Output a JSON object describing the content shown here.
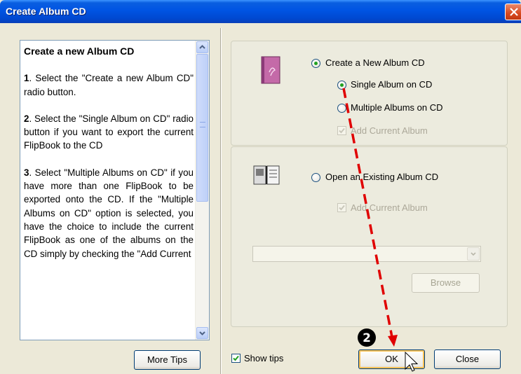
{
  "window": {
    "title": "Create Album CD"
  },
  "tips": {
    "heading": "Create a new Album CD",
    "steps": [
      {
        "num": "1",
        "text": ". Select the \"Create a new Album CD\" radio button."
      },
      {
        "num": "2",
        "text": ". Select the \"Single Album on CD\" radio button if you want to export the current FlipBook to the CD"
      },
      {
        "num": "3",
        "text": ". Select \"Multiple Albums on CD\" if you have more than one FlipBook to be exported onto the CD. If the \"Multiple Albums on CD\" option is selected, you have the choice to include the current FlipBook as one of the albums on the CD simply by checking the \"Add Current"
      }
    ]
  },
  "options": {
    "create_new": {
      "label": "Create a New Album CD",
      "selected": true
    },
    "single": {
      "label": "Single Album on CD",
      "selected": true
    },
    "multiple": {
      "label": "Multiple Albums on CD",
      "selected": false
    },
    "add_current_1": {
      "label": "Add Current Album",
      "checked": true,
      "enabled": false
    },
    "open_existing": {
      "label": "Open an Existing Album CD",
      "selected": false
    },
    "add_current_2": {
      "label": "Add Current Album",
      "checked": true,
      "enabled": false
    },
    "path_value": ""
  },
  "buttons": {
    "more_tips": "More Tips",
    "browse": "Browse",
    "ok": "OK",
    "close": "Close"
  },
  "show_tips": {
    "label": "Show tips",
    "checked": true
  },
  "annotation": {
    "step_badge": "2",
    "color": "#e00000"
  },
  "colors": {
    "titlebar": "#0054e3",
    "radio_dot": "#21a121",
    "badge": "#000000"
  }
}
